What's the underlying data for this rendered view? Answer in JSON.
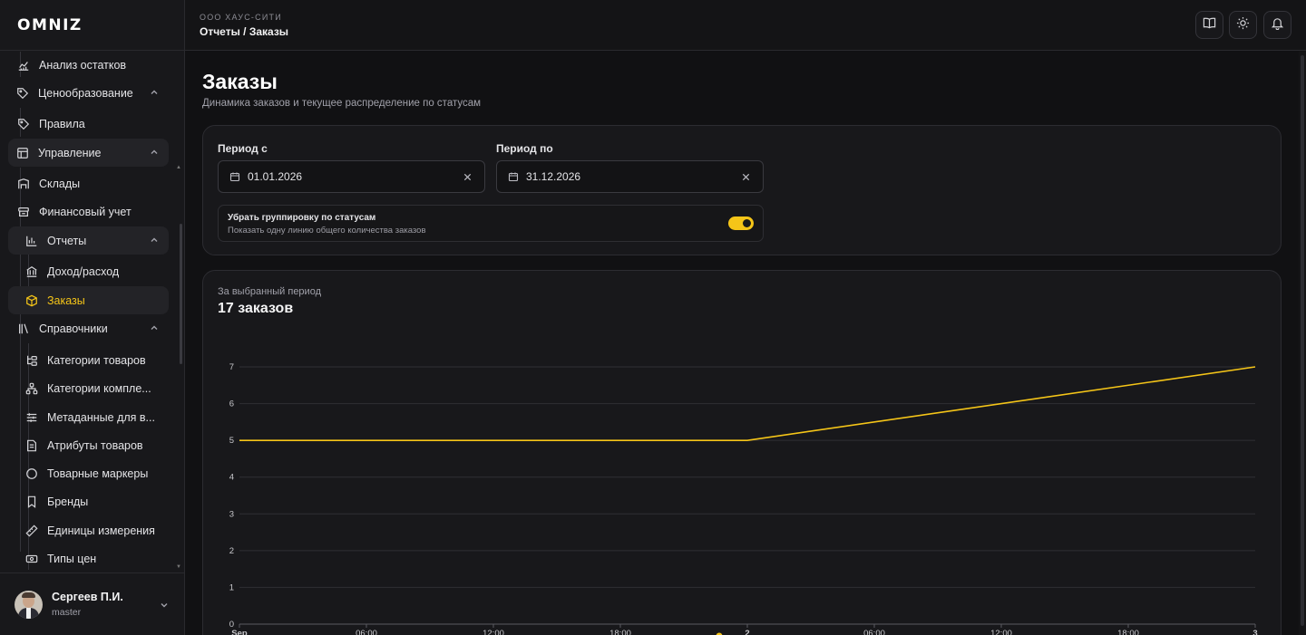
{
  "app": {
    "logo": "OMNIZ"
  },
  "header": {
    "org": "ООО ХАУС-СИТИ",
    "breadcrumb": "Отчеты / Заказы",
    "buttons": [
      {
        "icon": "book-icon"
      },
      {
        "icon": "sun-icon"
      },
      {
        "icon": "bell-icon"
      }
    ]
  },
  "sidebar": {
    "items": [
      {
        "label": "Анализ остатков",
        "icon": "chart-line-icon"
      },
      {
        "label": "Ценообразование",
        "icon": "tags-icon",
        "expanded": true
      },
      {
        "label": "Правила",
        "icon": "tag-icon"
      },
      {
        "label": "Управление",
        "icon": "layout-icon",
        "expanded": true
      },
      {
        "label": "Склады",
        "icon": "warehouse-icon"
      },
      {
        "label": "Финансовый учет",
        "icon": "archive-icon"
      },
      {
        "label": "Отчеты",
        "icon": "bar-chart-icon",
        "expanded": true
      },
      {
        "label": "Доход/расход",
        "icon": "bank-icon"
      },
      {
        "label": "Заказы",
        "icon": "box-icon",
        "selected": true
      },
      {
        "label": "Справочники",
        "icon": "library-icon",
        "expanded": true
      },
      {
        "label": "Категории товаров",
        "icon": "folder-tree-icon"
      },
      {
        "label": "Категории компле...",
        "icon": "network-icon"
      },
      {
        "label": "Метаданные для в...",
        "icon": "sliders-icon"
      },
      {
        "label": "Атрибуты товаров",
        "icon": "file-text-icon"
      },
      {
        "label": "Товарные маркеры",
        "icon": "circle-icon"
      },
      {
        "label": "Бренды",
        "icon": "bookmark-icon"
      },
      {
        "label": "Единицы измерения",
        "icon": "ruler-icon"
      },
      {
        "label": "Типы цен",
        "icon": "banknote-icon"
      }
    ],
    "user": {
      "name": "Сергеев П.И.",
      "role": "master"
    }
  },
  "page": {
    "title": "Заказы",
    "subtitle": "Динамика заказов и текущее распределение по статусам"
  },
  "filters": {
    "from_label": "Период с",
    "from_value": "01.01.2026",
    "to_label": "Период по",
    "to_value": "31.12.2026",
    "toggle_title": "Убрать группировку по статусам",
    "toggle_sub": "Показать одну линию общего количества заказов",
    "toggle_on": true
  },
  "summary": {
    "label": "За выбранный период",
    "count": "17 заказов"
  },
  "colors": {
    "accent": "#f5c518",
    "background": "#111113",
    "panel": "#18181b"
  },
  "chart_data": {
    "type": "line",
    "x_ticks": [
      "Sep",
      "06:00",
      "12:00",
      "18:00",
      "2",
      "06:00",
      "12:00",
      "18:00",
      "3"
    ],
    "y_ticks": [
      "0",
      "1",
      "2",
      "3",
      "4",
      "5",
      "6",
      "7"
    ],
    "ylim": [
      0,
      7
    ],
    "grid": true,
    "series": [
      {
        "color": "#f5c518",
        "points": [
          [
            "Sep 1 00:00",
            5
          ],
          [
            "Sep 2 00:00",
            5
          ],
          [
            "Sep 3 00:00",
            7
          ]
        ]
      }
    ]
  }
}
